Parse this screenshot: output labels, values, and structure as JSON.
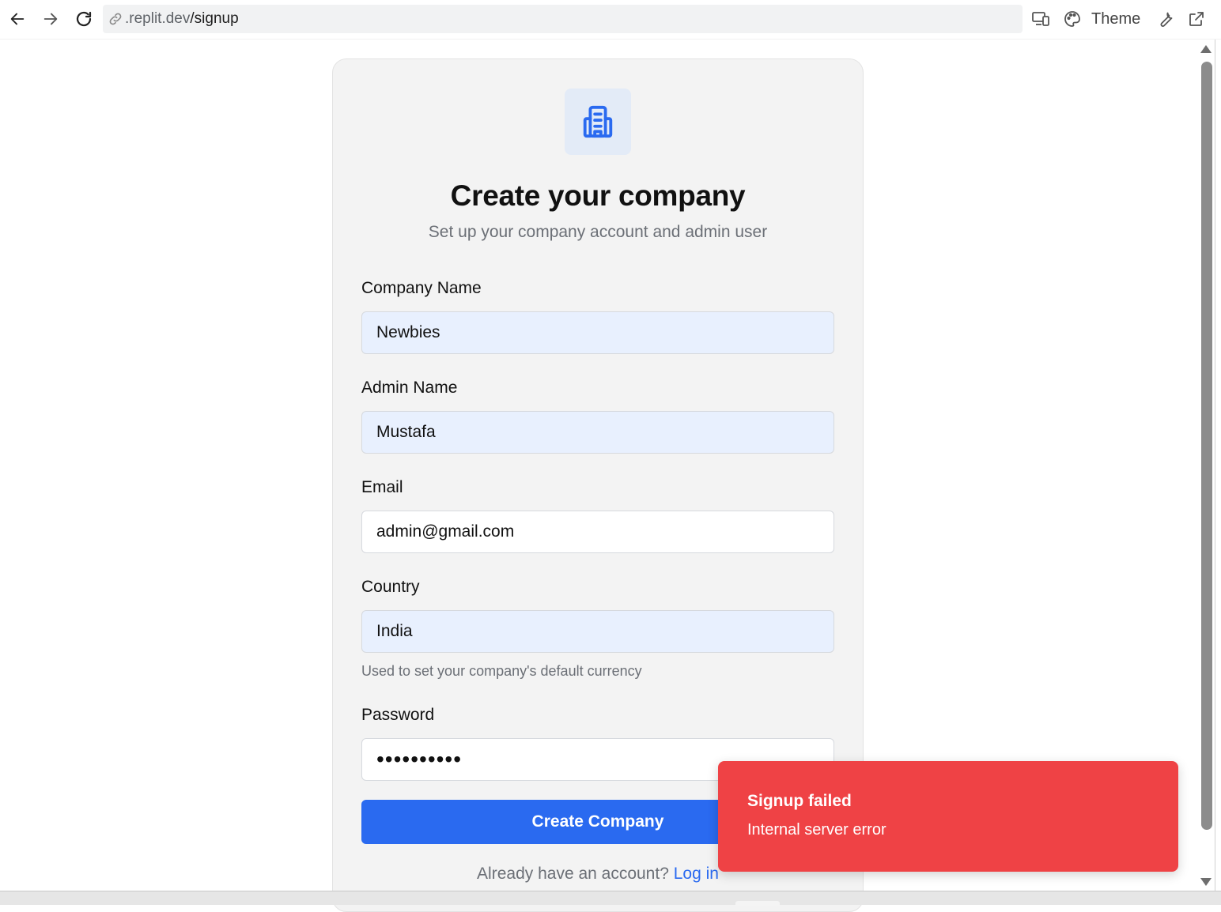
{
  "browser": {
    "url_host": ".replit.dev",
    "url_path": "/signup",
    "theme_label": "Theme"
  },
  "icons": {
    "back": "arrow-left-icon",
    "forward": "arrow-right-icon",
    "reload": "reload-icon",
    "link": "link-icon",
    "devices": "devices-icon",
    "palette": "palette-icon",
    "wrench": "wrench-icon",
    "external": "external-link-icon",
    "building": "building-icon"
  },
  "signup": {
    "title": "Create your company",
    "subtitle": "Set up your company account and admin user",
    "fields": {
      "company_name": {
        "label": "Company Name",
        "value": "Newbies"
      },
      "admin_name": {
        "label": "Admin Name",
        "value": "Mustafa"
      },
      "email": {
        "label": "Email",
        "value": "admin@gmail.com"
      },
      "country": {
        "label": "Country",
        "value": "India",
        "helper": "Used to set your company's default currency"
      },
      "password": {
        "label": "Password",
        "value": "••••••••••"
      }
    },
    "submit_label": "Create Company",
    "login_prompt": "Already have an account?",
    "login_link": "Log in"
  },
  "toast": {
    "title": "Signup failed",
    "description": "Internal server error"
  },
  "colors": {
    "primary": "#2a6af0",
    "toast_error": "#ef4245",
    "card_bg": "#f3f3f3",
    "autofill_bg": "#e8f0fe"
  }
}
